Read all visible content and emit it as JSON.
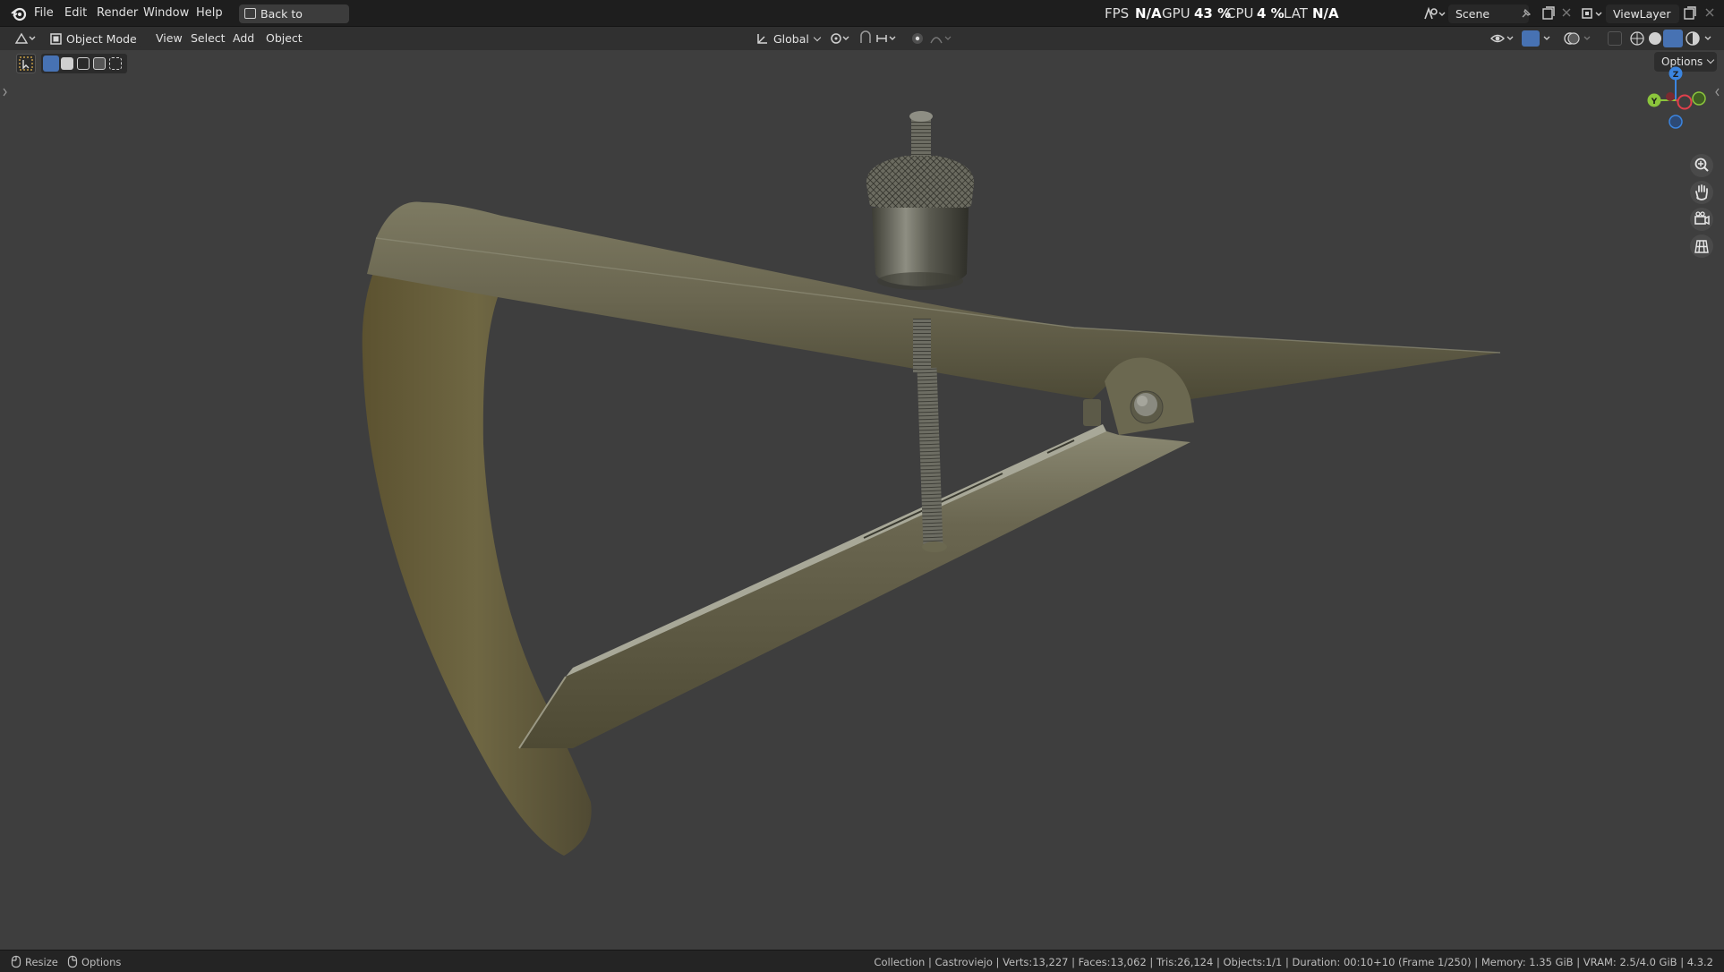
{
  "topbar": {
    "menus": [
      "File",
      "Edit",
      "Render",
      "Window",
      "Help"
    ],
    "back_button": "Back to Previous",
    "scene": "Scene",
    "view_layer": "ViewLayer"
  },
  "header": {
    "mode": "Object Mode",
    "menus": [
      "View",
      "Select",
      "Add",
      "Object"
    ],
    "transform_orientation": "Global",
    "options_label": "Options"
  },
  "perf": {
    "fps_label": "FPS",
    "fps_value": "N/A",
    "gpu_label": "GPU",
    "gpu_value": "43 %",
    "cpu_label": "CPU",
    "cpu_value": "4 %",
    "lat_label": "LAT",
    "lat_value": "N/A"
  },
  "gizmo": {
    "z": "Z",
    "y": "Y",
    "x": "X"
  },
  "statusbar": {
    "left_resize": "Resize",
    "left_options": "Options",
    "info": "Collection | Castroviejo | Verts:13,227 | Faces:13,062 | Tris:26,124 | Objects:1/1 | Duration: 00:10+10 (Frame 1/250) | Memory: 1.35 GiB | VRAM: 2.5/4.0 GiB | 4.3.2"
  },
  "colors": {
    "viewport_bg": "#3e3e3e",
    "metal": "#5f5b3f",
    "accent_blue": "#4772b3",
    "axis_x": "#e0404c",
    "axis_y": "#8bc53c",
    "axis_z": "#3b85e0"
  },
  "icons": [
    "blender-logo-icon",
    "editor-type-icon",
    "select-box-icon",
    "transform-orientation-icon",
    "pivot-icon",
    "snap-icon",
    "proportional-icon",
    "overlay-icon",
    "shading-wire-icon",
    "shading-solid-icon",
    "shading-material-icon",
    "shading-rendered-icon",
    "zoom-icon",
    "pan-hand-icon",
    "camera-icon",
    "grid-ortho-icon"
  ]
}
